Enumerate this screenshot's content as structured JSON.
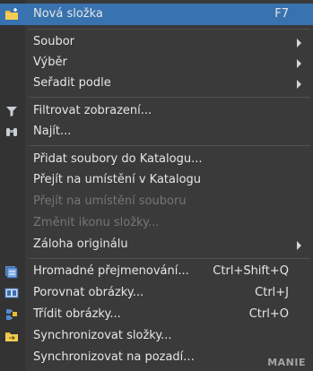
{
  "menu": {
    "items": [
      {
        "label": "Nová složka",
        "shortcut": "F7",
        "icon": "new-folder-icon",
        "highlight": true
      },
      {
        "label": "Soubor",
        "submenu": true
      },
      {
        "label": "Výběr",
        "submenu": true
      },
      {
        "label": "Seřadit podle",
        "submenu": true
      },
      {
        "label": "Filtrovat zobrazení...",
        "icon": "filter-icon"
      },
      {
        "label": "Najít...",
        "icon": "binoculars-icon"
      },
      {
        "label": "Přidat soubory do Katalogu..."
      },
      {
        "label": "Přejít na umístění v Katalogu"
      },
      {
        "label": "Přejít na umístění souboru",
        "disabled": true
      },
      {
        "label": "Změnit ikonu složky...",
        "disabled": true
      },
      {
        "label": "Záloha originálu",
        "submenu": true
      },
      {
        "label": "Hromadné přejmenování...",
        "shortcut": "Ctrl+Shift+Q",
        "icon": "batch-rename-icon"
      },
      {
        "label": "Porovnat obrázky...",
        "shortcut": "Ctrl+J",
        "icon": "compare-icon"
      },
      {
        "label": "Třídit obrázky...",
        "shortcut": "Ctrl+O",
        "icon": "sort-images-icon"
      },
      {
        "label": "Synchronizovat složky...",
        "icon": "sync-folders-icon"
      },
      {
        "label": "Synchronizovat na pozadí..."
      }
    ],
    "watermark": "MANIE"
  },
  "colors": {
    "highlight": "#3873b0",
    "background": "#3a3a3a",
    "text": "#e6e6e6",
    "disabled": "#767676"
  }
}
